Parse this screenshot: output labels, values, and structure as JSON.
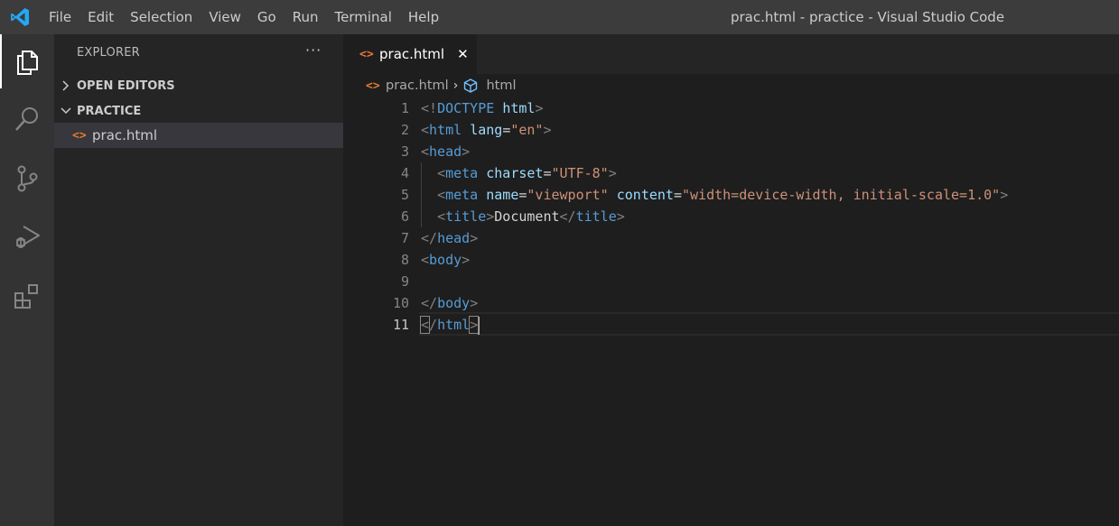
{
  "menu": [
    "File",
    "Edit",
    "Selection",
    "View",
    "Go",
    "Run",
    "Terminal",
    "Help"
  ],
  "window_title": "prac.html - practice - Visual Studio Code",
  "activity_bar": [
    "explorer-icon",
    "search-icon",
    "source-control-icon",
    "run-debug-icon",
    "extensions-icon"
  ],
  "sidebar": {
    "title": "EXPLORER",
    "more": "···",
    "open_editors": "OPEN EDITORS",
    "folder": "PRACTICE",
    "file": "prac.html",
    "file_icon": "<>"
  },
  "tab": {
    "label": "prac.html",
    "close": "✕",
    "icon": "<>"
  },
  "breadcrumb": {
    "file": "prac.html",
    "separator": "›",
    "symbol": "html"
  },
  "editor": {
    "line_numbers": [
      "1",
      "2",
      "3",
      "4",
      "5",
      "6",
      "7",
      "8",
      "9",
      "10",
      "11"
    ],
    "lines": [
      "<!DOCTYPE html>",
      "<html lang=\"en\">",
      "<head>",
      "  <meta charset=\"UTF-8\">",
      "  <meta name=\"viewport\" content=\"width=device-width, initial-scale=1.0\">",
      "  <title>Document</title>",
      "</head>",
      "<body>",
      "",
      "</body>",
      "</html>"
    ],
    "current_line": 11
  },
  "colors": {
    "accent_html": "#e37933",
    "tag": "#569cd6",
    "attr": "#9cdcfe",
    "string": "#ce9178",
    "punct": "#808080",
    "vscode_blue": "#23a9f2"
  }
}
